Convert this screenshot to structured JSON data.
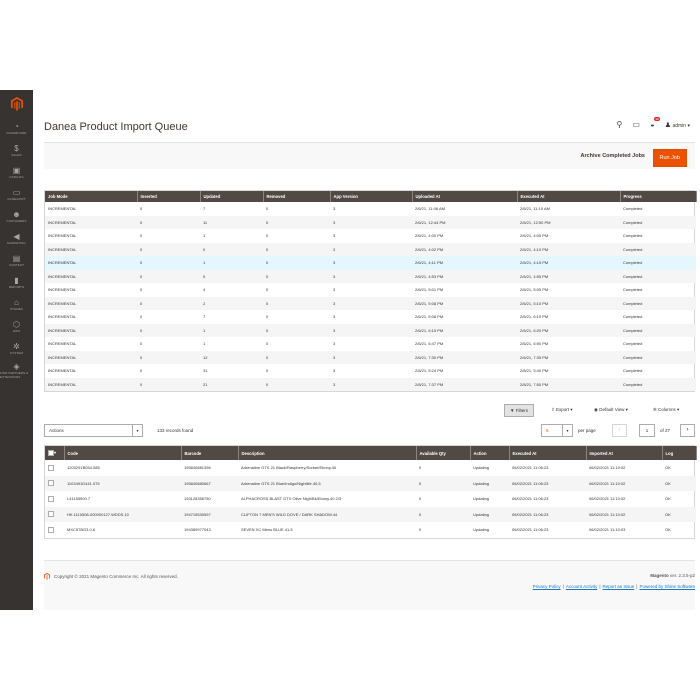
{
  "app": {
    "logo_color": "#eb5202",
    "accent": "#eb5202",
    "header_bg": "#514943"
  },
  "sidebar": {
    "items": [
      {
        "icon": "dashboard-icon",
        "glyph": "◔",
        "label": "Dashboard"
      },
      {
        "icon": "dollar-icon",
        "glyph": "$",
        "label": "Sales"
      },
      {
        "icon": "cube-icon",
        "glyph": "▣",
        "label": "Catalog"
      },
      {
        "icon": "monitor-icon",
        "glyph": "▭",
        "label": "Danea/PRT"
      },
      {
        "icon": "people-icon",
        "glyph": "☻",
        "label": "Customers"
      },
      {
        "icon": "megaphone-icon",
        "glyph": "◀",
        "label": "Marketing"
      },
      {
        "icon": "layout-icon",
        "glyph": "▤",
        "label": "Content"
      },
      {
        "icon": "bar-chart-icon",
        "glyph": "▮",
        "label": "Reports"
      },
      {
        "icon": "store-icon",
        "glyph": "⌂",
        "label": "Stores"
      },
      {
        "icon": "hexagon-icon",
        "glyph": "⬡",
        "label": "Hiku"
      },
      {
        "icon": "gear-icon",
        "glyph": "✲",
        "label": "System"
      },
      {
        "icon": "puzzle-icon",
        "glyph": "◈",
        "label": "Find Partners &amp; Extensions"
      }
    ]
  },
  "header": {
    "title": "Danea Product Import Queue",
    "notif_count": "99",
    "user": "admin ▾"
  },
  "actionbar": {
    "archive_label": "Archive Completed Jobs",
    "run_label": "Run Job"
  },
  "jobs": {
    "headers": [
      "Job Mode",
      "Inserted",
      "Updated",
      "Removed",
      "App Version",
      "Uploaded At",
      "Executed At",
      "Progress"
    ],
    "rows": [
      [
        "INCREMENTAL",
        "0",
        "7",
        "0",
        "3",
        "2/6/21, 11:06 AM",
        "2/6/21, 11:10 AM",
        "Completed"
      ],
      [
        "INCREMENTAL",
        "0",
        "11",
        "0",
        "3",
        "2/6/21, 12:44 PM",
        "2/6/21, 12:50 PM",
        "Completed"
      ],
      [
        "INCREMENTAL",
        "0",
        "1",
        "0",
        "3",
        "2/6/21, 4:00 PM",
        "2/6/21, 4:05 PM",
        "Completed"
      ],
      [
        "INCREMENTAL",
        "0",
        "0",
        "0",
        "3",
        "2/6/21, 4:02 PM",
        "2/6/21, 4:10 PM",
        "Completed"
      ],
      [
        "INCREMENTAL",
        "0",
        "1",
        "0",
        "3",
        "2/6/21, 4:11 PM",
        "2/6/21, 4:15 PM",
        "Completed"
      ],
      [
        "INCREMENTAL",
        "0",
        "5",
        "0",
        "3",
        "2/6/21, 4:53 PM",
        "2/6/21, 4:55 PM",
        "Completed"
      ],
      [
        "INCREMENTAL",
        "0",
        "4",
        "0",
        "3",
        "2/6/21, 5:01 PM",
        "2/6/21, 5:05 PM",
        "Completed"
      ],
      [
        "INCREMENTAL",
        "0",
        "2",
        "0",
        "3",
        "2/6/21, 5:08 PM",
        "2/6/21, 5:10 PM",
        "Completed"
      ],
      [
        "INCREMENTAL",
        "0",
        "7",
        "0",
        "3",
        "2/6/21, 6:08 PM",
        "2/6/21, 6:10 PM",
        "Completed"
      ],
      [
        "INCREMENTAL",
        "0",
        "1",
        "0",
        "3",
        "2/6/21, 6:15 PM",
        "2/6/21, 6:20 PM",
        "Completed"
      ],
      [
        "INCREMENTAL",
        "0",
        "1",
        "0",
        "3",
        "2/6/21, 6:47 PM",
        "2/6/21, 6:50 PM",
        "Completed"
      ],
      [
        "INCREMENTAL",
        "0",
        "12",
        "0",
        "3",
        "2/6/21, 7:30 PM",
        "2/6/21, 7:35 PM",
        "Completed"
      ],
      [
        "INCREMENTAL",
        "0",
        "31",
        "0",
        "3",
        "2/8/21, 5:24 PM",
        "2/8/21, 5:40 PM",
        "Completed"
      ],
      [
        "INCREMENTAL",
        "0",
        "21",
        "0",
        "3",
        "2/8/21, 7:37 PM",
        "2/8/21, 7:50 PM",
        "Completed"
      ]
    ]
  },
  "grid_toolbar": {
    "filters_label": "Filters",
    "export_label": "Export ▾",
    "view_label": "Default View ▾",
    "columns_label": "Columns ▾"
  },
  "grid_controls": {
    "actions_label": "Actions",
    "records_found": "133 records found",
    "per_page_value": "5",
    "per_page_label": "per page",
    "current_page": "1",
    "of_pages": "of 27"
  },
  "products": {
    "headers": [
      "Code",
      "Barcode",
      "Description",
      "Available Qty",
      "Action",
      "Executed At",
      "Imported At",
      "Log"
    ],
    "rows": [
      [
        "1203291B054.085",
        "195840881396",
        "Adrenaline GTS 21 Black/Raspberry/Sorbet/Ebony.40",
        "0",
        "Updating",
        "06/02/2021 11:06:23",
        "06/02/2021 11:10:02",
        "OK"
      ],
      [
        "1103491D441.075",
        "195840880667",
        "Adrenaline GTS 21 Blue/Indigo/Nightlife.40,5",
        "0",
        "Updating",
        "06/02/2021 11:06:23",
        "06/02/2021 11:10:02",
        "OK"
      ],
      [
        "L41155900.7",
        "193128356750",
        "ALPHACROSS BLAST GTX Olive Nigh/Bk/Ebony.40 2/3",
        "0",
        "Updating",
        "06/02/2021 11:06:23",
        "06/02/2021 11:10:02",
        "OK"
      ],
      [
        "HK.1110508-000000127.WDDS.10",
        "194715530597",
        "CLIFTON 7 MEN'S WILD DOVE / DARK SHADOW.44",
        "0",
        "Updating",
        "06/02/2021 11:06:23",
        "06/02/2021 11:10:02",
        "OK"
      ],
      [
        "MXC57BG3.0.6",
        "194389977043",
        "SEVEN XC Mens BLUE.41,5",
        "0",
        "Updating",
        "06/02/2021 11:06:23",
        "06/02/2021 11:10:03",
        "OK"
      ]
    ]
  },
  "footer": {
    "copyright": "Copyright © 2021 Magento Commerce Inc. All rights reserved.",
    "brand": "Magento",
    "version": "ver. 2.3.5-p2",
    "links": [
      "Privacy Policy",
      "Account Activity",
      "Report an Issue",
      "Powered by Shine Software"
    ]
  }
}
